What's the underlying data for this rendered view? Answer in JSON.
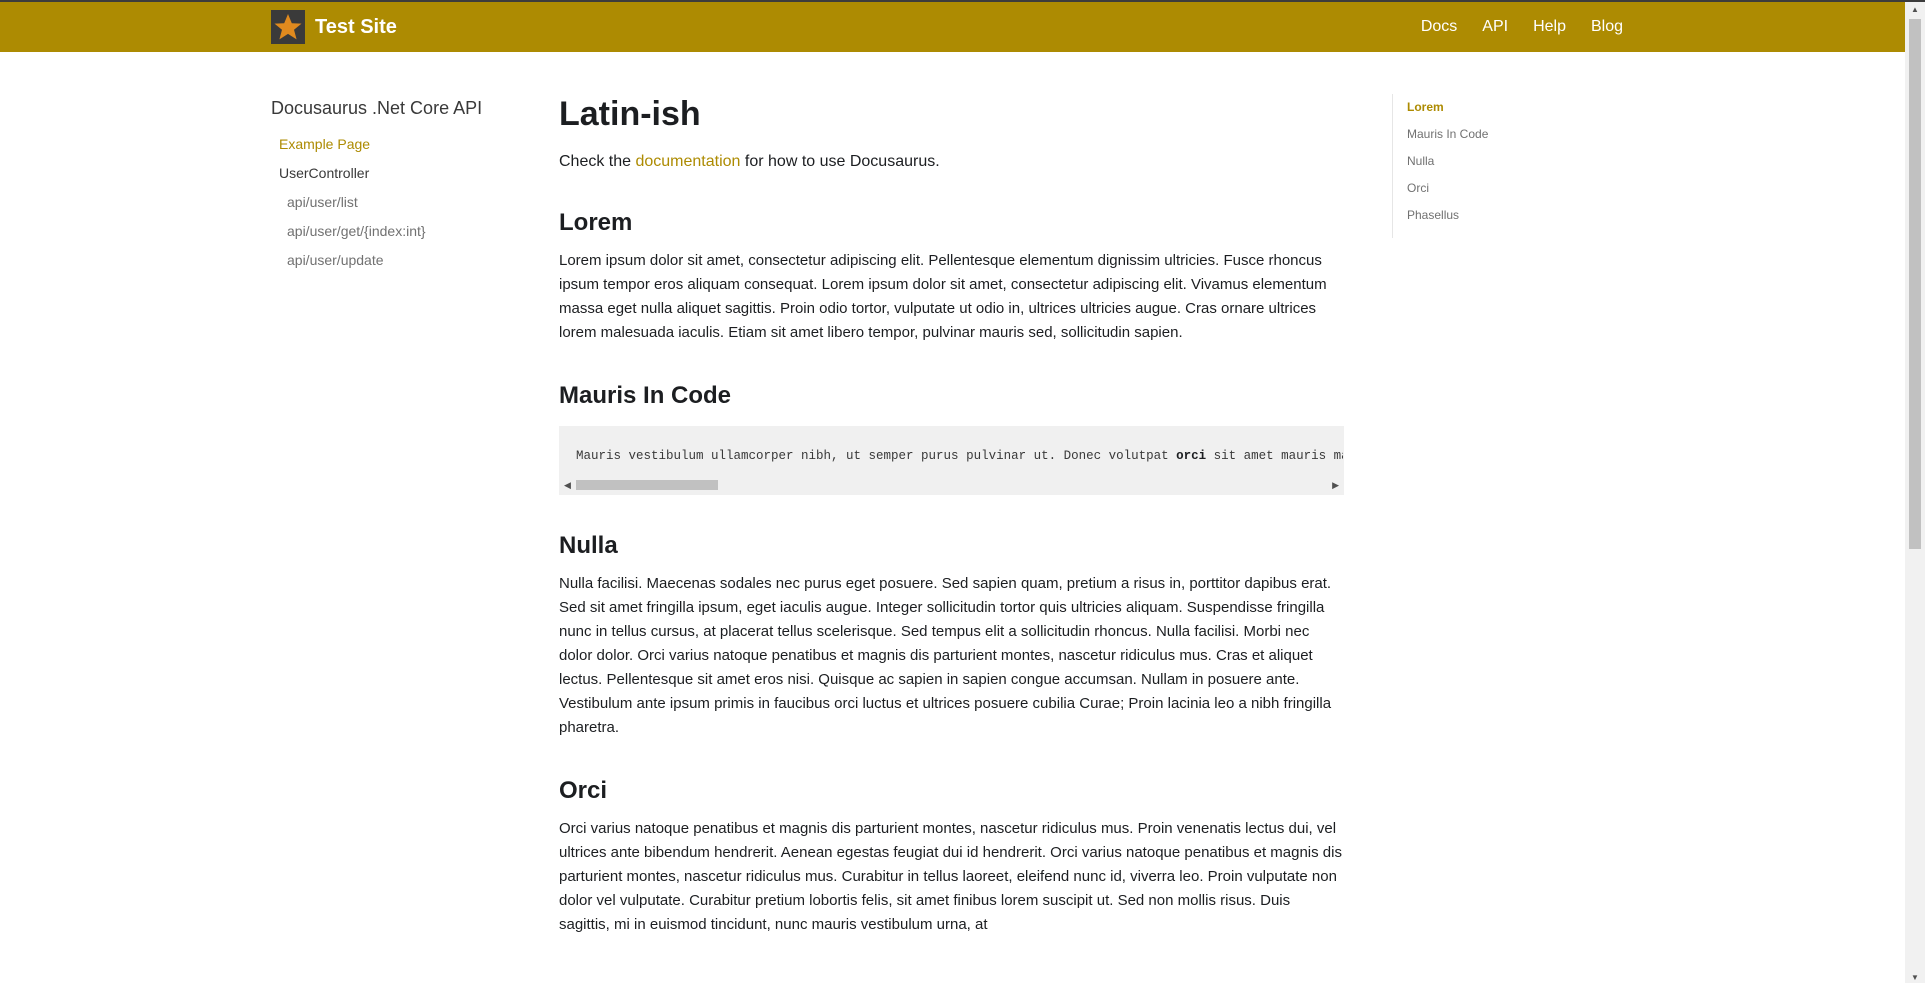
{
  "header": {
    "site_title": "Test Site",
    "logo_icon": "star-icon",
    "nav": [
      "Docs",
      "API",
      "Help",
      "Blog"
    ]
  },
  "sidebar": {
    "title": "Docusaurus .Net Core API",
    "items": [
      {
        "label": "Example Page",
        "type": "active"
      },
      {
        "label": "UserController",
        "type": "category"
      },
      {
        "label": "api/user/list",
        "type": "sub"
      },
      {
        "label": "api/user/get/{index:int}",
        "type": "sub"
      },
      {
        "label": "api/user/update",
        "type": "sub"
      }
    ]
  },
  "main": {
    "title": "Latin-ish",
    "intro_before": "Check the ",
    "intro_link": "documentation",
    "intro_after": " for how to use Docusaurus.",
    "sections": {
      "lorem": {
        "heading": "Lorem",
        "text": "Lorem ipsum dolor sit amet, consectetur adipiscing elit. Pellentesque elementum dignissim ultricies. Fusce rhoncus ipsum tempor eros aliquam consequat. Lorem ipsum dolor sit amet, consectetur adipiscing elit. Vivamus elementum massa eget nulla aliquet sagittis. Proin odio tortor, vulputate ut odio in, ultrices ultricies augue. Cras ornare ultrices lorem malesuada iaculis. Etiam sit amet libero tempor, pulvinar mauris sed, sollicitudin sapien."
      },
      "mauris": {
        "heading": "Mauris In Code",
        "code_before": "Mauris vestibulum ullamcorper nibh, ut semper purus pulvinar ut. Donec volutpat ",
        "code_bold": "orci",
        "code_after": " sit amet mauris ma"
      },
      "nulla": {
        "heading": "Nulla",
        "text": "Nulla facilisi. Maecenas sodales nec purus eget posuere. Sed sapien quam, pretium a risus in, porttitor dapibus erat. Sed sit amet fringilla ipsum, eget iaculis augue. Integer sollicitudin tortor quis ultricies aliquam. Suspendisse fringilla nunc in tellus cursus, at placerat tellus scelerisque. Sed tempus elit a sollicitudin rhoncus. Nulla facilisi. Morbi nec dolor dolor. Orci varius natoque penatibus et magnis dis parturient montes, nascetur ridiculus mus. Cras et aliquet lectus. Pellentesque sit amet eros nisi. Quisque ac sapien in sapien congue accumsan. Nullam in posuere ante. Vestibulum ante ipsum primis in faucibus orci luctus et ultrices posuere cubilia Curae; Proin lacinia leo a nibh fringilla pharetra."
      },
      "orci": {
        "heading": "Orci",
        "text": "Orci varius natoque penatibus et magnis dis parturient montes, nascetur ridiculus mus. Proin venenatis lectus dui, vel ultrices ante bibendum hendrerit. Aenean egestas feugiat dui id hendrerit. Orci varius natoque penatibus et magnis dis parturient montes, nascetur ridiculus mus. Curabitur in tellus laoreet, eleifend nunc id, viverra leo. Proin vulputate non dolor vel vulputate. Curabitur pretium lobortis felis, sit amet finibus lorem suscipit ut. Sed non mollis risus. Duis sagittis, mi in euismod tincidunt, nunc mauris vestibulum urna, at"
      }
    }
  },
  "toc": {
    "items": [
      "Lorem",
      "Mauris In Code",
      "Nulla",
      "Orci",
      "Phasellus"
    ],
    "active": "Lorem"
  },
  "colors": {
    "accent": "#ad8b02",
    "code_bg": "#f0f0f0",
    "logo_star": "#e08a1e"
  }
}
